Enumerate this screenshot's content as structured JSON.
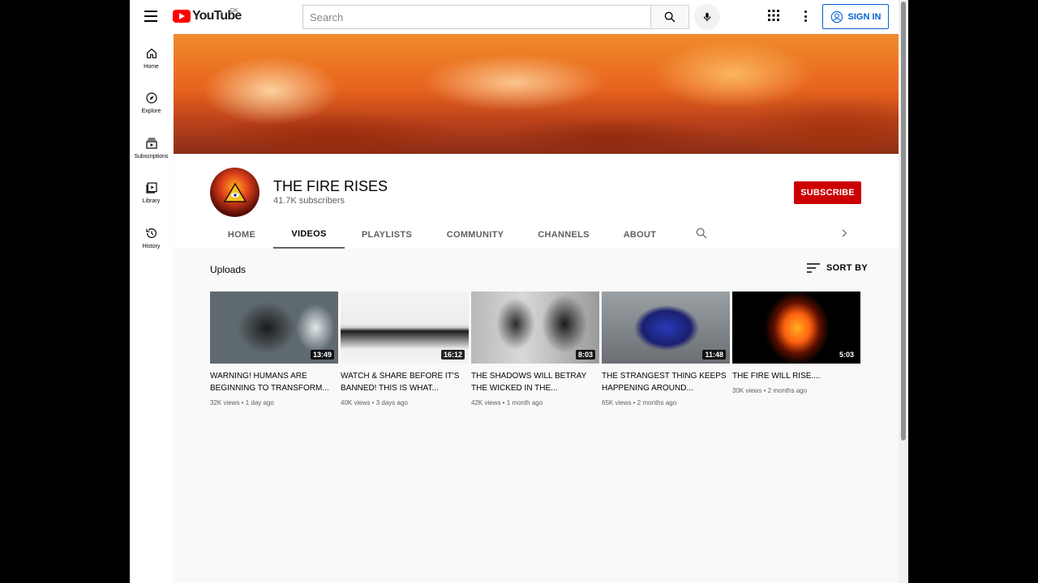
{
  "header": {
    "logo_text": "YouTube",
    "country_code": "DK",
    "search_placeholder": "Search",
    "signin_label": "SIGN IN"
  },
  "sidebar": {
    "items": [
      {
        "label": "Home",
        "icon": "home-icon"
      },
      {
        "label": "Explore",
        "icon": "compass-icon"
      },
      {
        "label": "Subscriptions",
        "icon": "subscriptions-icon"
      },
      {
        "label": "Library",
        "icon": "library-icon"
      },
      {
        "label": "History",
        "icon": "history-icon"
      }
    ]
  },
  "channel": {
    "name": "THE FIRE RISES",
    "subscribers": "41.7K subscribers",
    "subscribe_label": "SUBSCRIBE"
  },
  "tabs": [
    {
      "label": "HOME",
      "active": false
    },
    {
      "label": "VIDEOS",
      "active": true
    },
    {
      "label": "PLAYLISTS",
      "active": false
    },
    {
      "label": "COMMUNITY",
      "active": false
    },
    {
      "label": "CHANNELS",
      "active": false
    },
    {
      "label": "ABOUT",
      "active": false
    }
  ],
  "uploads": {
    "title": "Uploads",
    "sort_label": "SORT BY",
    "videos": [
      {
        "title": "WARNING! HUMANS ARE BEGINNING TO TRANSFORM...",
        "duration": "13:49",
        "meta": "32K views • 1 day ago"
      },
      {
        "title": "WATCH & SHARE BEFORE IT'S BANNED! THIS IS WHAT...",
        "duration": "16:12",
        "meta": "40K views • 3 days ago"
      },
      {
        "title": "THE SHADOWS WILL BETRAY THE WICKED IN THE...",
        "duration": "8:03",
        "meta": "42K views • 1 month ago"
      },
      {
        "title": "THE STRANGEST THING KEEPS HAPPENING AROUND...",
        "duration": "11:48",
        "meta": "65K views • 2 months ago"
      },
      {
        "title": "THE FIRE WILL RISE....",
        "duration": "5:03",
        "meta": "30K views • 2 months ago"
      }
    ]
  },
  "colors": {
    "brand_red": "#ff0000",
    "subscribe_red": "#cc0000",
    "signin_blue": "#065fd4"
  }
}
